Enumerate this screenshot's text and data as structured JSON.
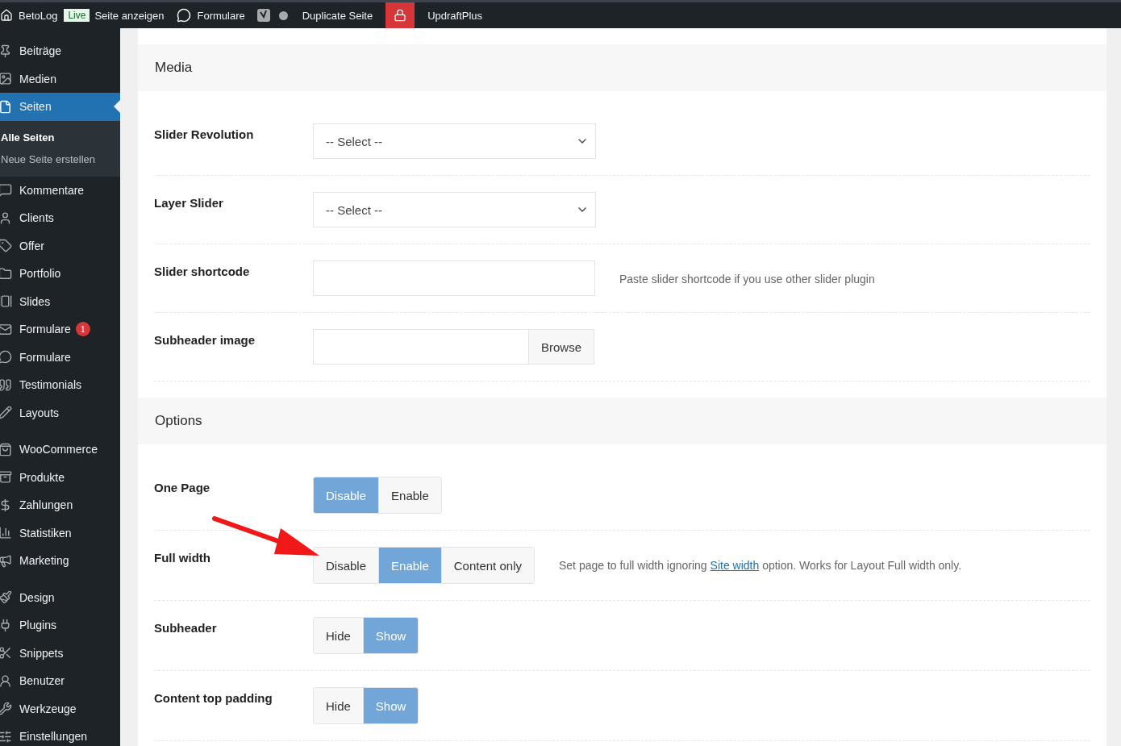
{
  "admin_bar": {
    "site": "BetoLog",
    "badge": "Live",
    "view": "Seite anzeigen",
    "forms": "Formulare",
    "duplicate": "Duplicate Seite",
    "updraft": "UpdraftPlus"
  },
  "sidebar": {
    "groups": [
      [
        {
          "label": "Beiträge",
          "selected": false
        },
        {
          "label": "Medien",
          "selected": false
        },
        {
          "label": "Seiten",
          "selected": true,
          "children": [
            {
              "label": "Alle Seiten",
              "selected": true
            },
            {
              "label": "Neue Seite erstellen",
              "selected": false
            }
          ]
        },
        {
          "label": "Kommentare",
          "selected": false
        },
        {
          "label": "Clients",
          "selected": false
        },
        {
          "label": "Offer",
          "selected": false
        },
        {
          "label": "Portfolio",
          "selected": false
        },
        {
          "label": "Slides",
          "selected": false
        },
        {
          "label": "Formulare",
          "selected": false,
          "count": "1"
        },
        {
          "label": "Formulare",
          "selected": false
        },
        {
          "label": "Testimonials",
          "selected": false
        },
        {
          "label": "Layouts",
          "selected": false
        }
      ],
      [
        {
          "label": "WooCommerce",
          "selected": false
        },
        {
          "label": "Produkte",
          "selected": false
        },
        {
          "label": "Zahlungen",
          "selected": false
        },
        {
          "label": "Statistiken",
          "selected": false
        },
        {
          "label": "Marketing",
          "selected": false
        }
      ],
      [
        {
          "label": "Design",
          "selected": false
        },
        {
          "label": "Plugins",
          "selected": false
        },
        {
          "label": "Snippets",
          "selected": false
        },
        {
          "label": "Benutzer",
          "selected": false
        },
        {
          "label": "Werkzeuge",
          "selected": false
        },
        {
          "label": "Einstellungen",
          "selected": false
        }
      ]
    ]
  },
  "sections": [
    {
      "title": "Media",
      "rows": [
        {
          "label": "Slider Revolution",
          "kind": "select",
          "value": "-- Select --"
        },
        {
          "label": "Layer Slider",
          "kind": "select",
          "value": "-- Select --"
        },
        {
          "label": "Slider shortcode",
          "kind": "text",
          "help": {
            "text": "Paste slider shortcode if you use other slider plugin"
          }
        },
        {
          "label": "Subheader image",
          "kind": "browse",
          "button": "Browse"
        }
      ]
    },
    {
      "title": "Options",
      "rows": [
        {
          "label": "One Page",
          "kind": "segmented",
          "options": [
            {
              "label": "Disable",
              "selected": true
            },
            {
              "label": "Enable",
              "selected": false
            }
          ]
        },
        {
          "label": "Full width",
          "kind": "segmented",
          "options": [
            {
              "label": "Disable",
              "selected": false
            },
            {
              "label": "Enable",
              "selected": true
            },
            {
              "label": "Content only",
              "selected": false
            }
          ],
          "help": {
            "text": "Set page to full width ignoring",
            "link": "Site width",
            "after": "option. Works for Layout Full width only."
          }
        },
        {
          "label": "Subheader",
          "kind": "segmented",
          "options": [
            {
              "label": "Hide",
              "selected": false
            },
            {
              "label": "Show",
              "selected": true
            }
          ]
        },
        {
          "label": "Content top padding",
          "kind": "segmented",
          "options": [
            {
              "label": "Hide",
              "selected": false
            },
            {
              "label": "Show",
              "selected": true
            }
          ]
        }
      ]
    }
  ]
}
